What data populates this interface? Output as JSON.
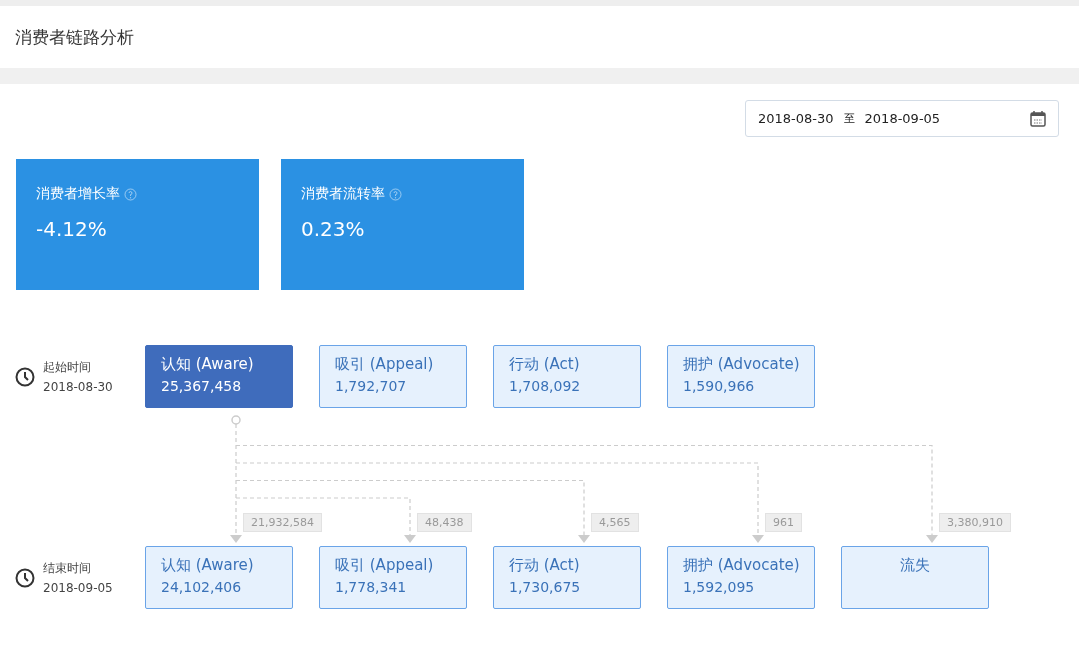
{
  "header": {
    "title": "消费者链路分析"
  },
  "date_range": {
    "start": "2018-08-30",
    "separator": "至",
    "end": "2018-09-05"
  },
  "kpis": [
    {
      "label": "消费者增长率",
      "value": "-4.12%"
    },
    {
      "label": "消费者流转率",
      "value": "0.23%"
    }
  ],
  "start_row": {
    "label": "起始时间",
    "date": "2018-08-30",
    "stages": [
      {
        "name": "认知 (Aware)",
        "value": "25,367,458",
        "selected": true
      },
      {
        "name": "吸引 (Appeal)",
        "value": "1,792,707",
        "selected": false
      },
      {
        "name": "行动 (Act)",
        "value": "1,708,092",
        "selected": false
      },
      {
        "name": "拥护 (Advocate)",
        "value": "1,590,966",
        "selected": false
      }
    ]
  },
  "flows": [
    {
      "count": "21,932,584"
    },
    {
      "count": "48,438"
    },
    {
      "count": "4,565"
    },
    {
      "count": "961"
    },
    {
      "count": "3,380,910"
    }
  ],
  "end_row": {
    "label": "结束时间",
    "date": "2018-09-05",
    "stages": [
      {
        "kind": "stage",
        "name": "认知 (Aware)",
        "value": "24,102,406"
      },
      {
        "kind": "stage",
        "name": "吸引 (Appeal)",
        "value": "1,778,341"
      },
      {
        "kind": "stage",
        "name": "行动 (Act)",
        "value": "1,730,675"
      },
      {
        "kind": "stage",
        "name": "拥护 (Advocate)",
        "value": "1,592,095"
      },
      {
        "kind": "churn",
        "name": "流失"
      }
    ]
  }
}
